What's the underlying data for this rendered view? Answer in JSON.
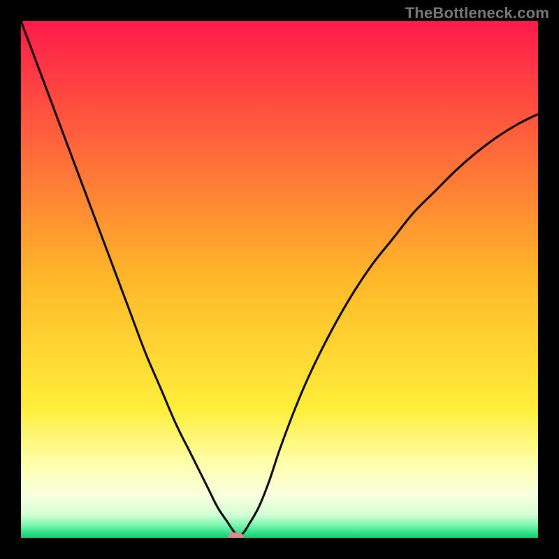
{
  "watermark": {
    "text": "TheBottleneck.com"
  },
  "chart_data": {
    "type": "line",
    "title": "",
    "xlabel": "",
    "ylabel": "",
    "xlim": [
      0,
      100
    ],
    "ylim": [
      0,
      100
    ],
    "grid": false,
    "legend": false,
    "background_gradient": {
      "stops": [
        {
          "pct": 0.0,
          "color": "#ff1a4b"
        },
        {
          "pct": 0.5,
          "color": "#ffb829"
        },
        {
          "pct": 0.75,
          "color": "#ffee3a"
        },
        {
          "pct": 0.86,
          "color": "#ffffb0"
        },
        {
          "pct": 0.92,
          "color": "#f7ffe0"
        },
        {
          "pct": 0.955,
          "color": "#d4ffd4"
        },
        {
          "pct": 0.975,
          "color": "#7cf7b0"
        },
        {
          "pct": 0.99,
          "color": "#2de28a"
        },
        {
          "pct": 1.0,
          "color": "#18c76f"
        }
      ]
    },
    "series": [
      {
        "name": "bottleneck-curve",
        "color": "#000000",
        "x": [
          0,
          3,
          6,
          9,
          12,
          15,
          18,
          21,
          24,
          27,
          30,
          33,
          36,
          38,
          40,
          41,
          42,
          43,
          44,
          46,
          48,
          50,
          53,
          56,
          60,
          64,
          68,
          72,
          76,
          80,
          84,
          88,
          92,
          96,
          100
        ],
        "y": [
          100,
          92,
          84,
          76,
          68,
          60,
          52,
          44,
          36,
          29,
          22,
          16,
          10,
          6,
          3,
          1.5,
          0.5,
          1.0,
          2.5,
          6,
          11,
          17,
          25,
          32,
          40,
          47,
          53,
          58,
          63,
          67,
          71,
          74.5,
          77.5,
          80,
          82
        ]
      }
    ],
    "annotations": [
      {
        "type": "marker",
        "shape": "pill",
        "x": 41.5,
        "y": 0.0,
        "color": "#d98d8a"
      }
    ]
  }
}
